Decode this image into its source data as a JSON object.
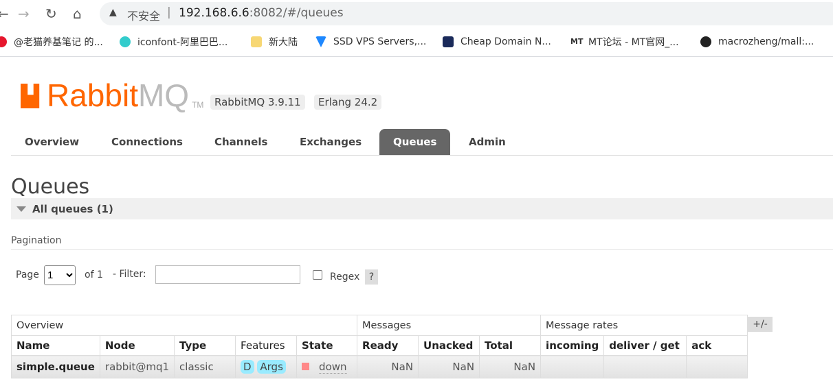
{
  "browser": {
    "insecure_label": "不安全",
    "url_host": "192.168.6.6",
    "url_rest": ":8082/#/queues",
    "bookmarks": [
      {
        "label": "@老猫养基笔记 的...",
        "icon": "weibo-icon",
        "color": "#e6162d"
      },
      {
        "label": "iconfont-阿里巴巴...",
        "icon": "iconfont-icon",
        "color": "#3cc"
      },
      {
        "label": "新大陆",
        "icon": "folder-icon",
        "color": "#f7d774"
      },
      {
        "label": "SSD VPS Servers,...",
        "icon": "vultr-icon",
        "color": "#1e88ff"
      },
      {
        "label": "Cheap Domain N...",
        "icon": "namecheap-icon",
        "color": "#1a2a5a"
      },
      {
        "label": "MT论坛 - MT官网_...",
        "icon": "mt-icon",
        "color": "#222"
      },
      {
        "label": "macrozheng/mall:...",
        "icon": "github-icon",
        "color": "#222"
      }
    ]
  },
  "header": {
    "logo_text": "RabbitMQ",
    "version": "RabbitMQ 3.9.11",
    "erlang": "Erlang 24.2"
  },
  "tabs": [
    "Overview",
    "Connections",
    "Channels",
    "Exchanges",
    "Queues",
    "Admin"
  ],
  "active_tab": "Queues",
  "page_title": "Queues",
  "section": "All queues (1)",
  "pagination": {
    "title": "Pagination",
    "page_label": "Page",
    "page_value": "1",
    "of_label": "of 1",
    "filter_label": "- Filter:",
    "filter_value": "",
    "regex_label": "Regex",
    "help": "?"
  },
  "table": {
    "groups": [
      "Overview",
      "Messages",
      "Message rates"
    ],
    "toggle": "+/-",
    "headers": [
      "Name",
      "Node",
      "Type",
      "Features",
      "State",
      "Ready",
      "Unacked",
      "Total",
      "incoming",
      "deliver / get",
      "ack"
    ],
    "rows": [
      {
        "name": "simple.queue",
        "node": "rabbit@mq1",
        "type": "classic",
        "features": [
          "D",
          "Args"
        ],
        "state": "down",
        "state_color": "#ff8888",
        "ready": "NaN",
        "unacked": "NaN",
        "total": "NaN",
        "incoming": "",
        "deliver_get": "",
        "ack": ""
      }
    ]
  }
}
